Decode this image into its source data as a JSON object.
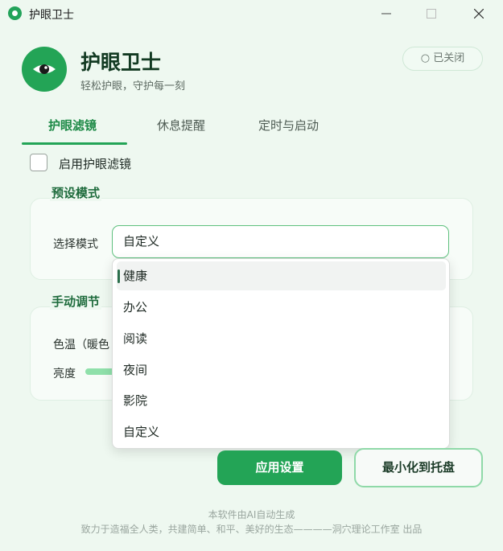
{
  "window": {
    "title": "护眼卫士",
    "controls": {
      "minimize": "—",
      "maximize": "☐",
      "close": "✕"
    }
  },
  "header": {
    "app_name": "护眼卫士",
    "slogan": "轻松护眼，守护每一刻",
    "status_text": "○ 已关闭",
    "logo_icon": "eye-icon"
  },
  "tabs": [
    {
      "label": "护眼滤镜",
      "active": true
    },
    {
      "label": "休息提醒",
      "active": false
    },
    {
      "label": "定时与启动",
      "active": false
    }
  ],
  "filter_tab": {
    "enable_checkbox": {
      "label": "启用护眼滤镜",
      "checked": false
    },
    "preset_section": {
      "title": "预设模式",
      "select_label": "选择模式",
      "selected_value": "自定义",
      "options": [
        "健康",
        "办公",
        "阅读",
        "夜间",
        "影院",
        "自定义"
      ],
      "highlighted_option": "健康"
    },
    "manual_section": {
      "title": "手动调节",
      "color_temp_label": "色温（暖色",
      "brightness_label": "亮度"
    }
  },
  "actions": {
    "apply_label": "应用设置",
    "minimize_tray_label": "最小化到托盘"
  },
  "footer": {
    "line1": "本软件由AI自动生成",
    "line2": "致力于造福全人类，共建简单、和平、美好的生态————洞穴理论工作室 出品"
  },
  "colors": {
    "accent": "#23a456",
    "background": "#eef8f0",
    "heading": "#1e6b3c"
  }
}
